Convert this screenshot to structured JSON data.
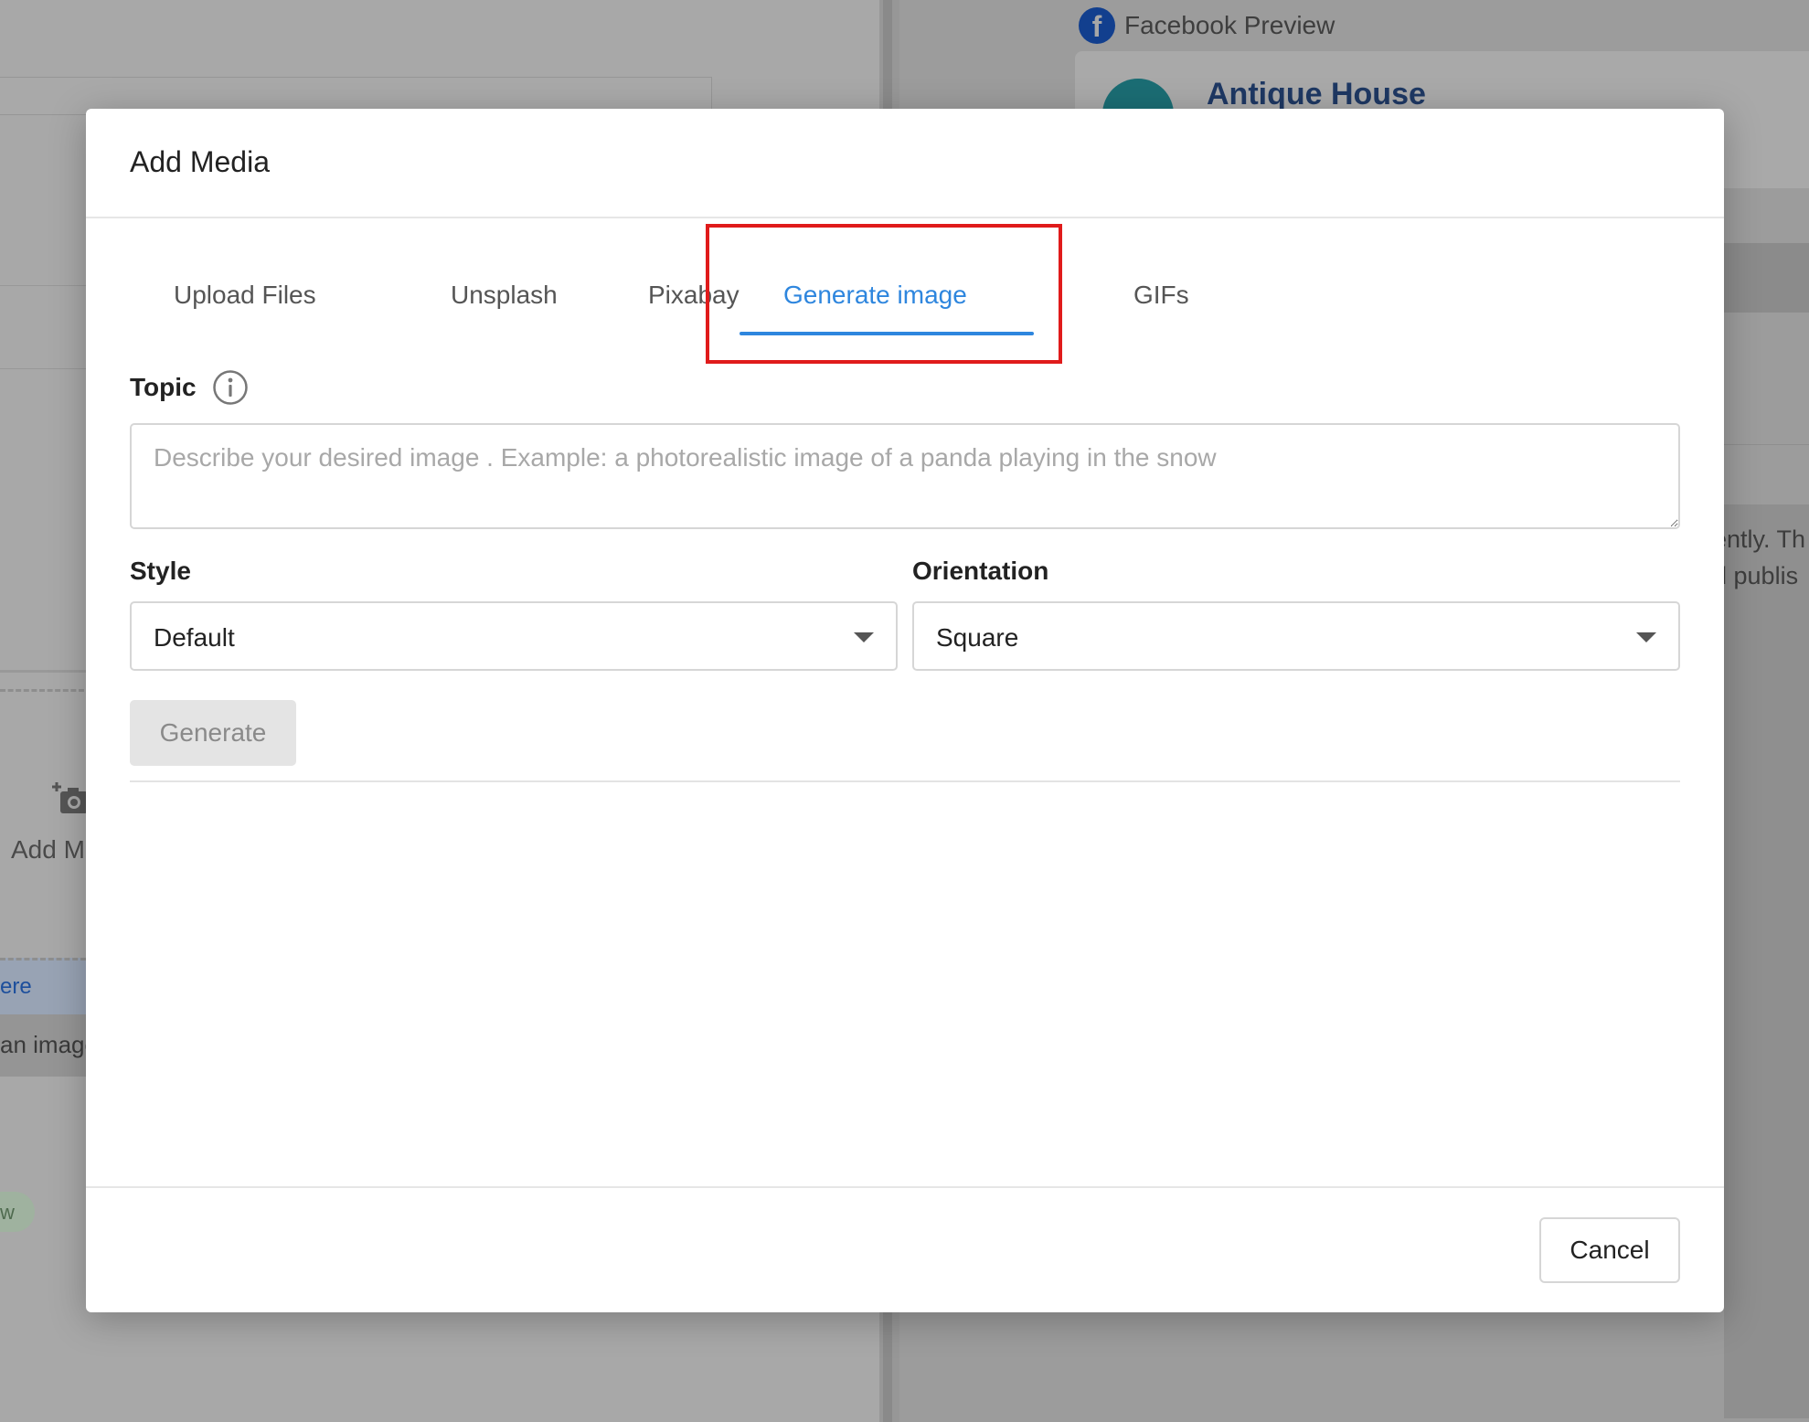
{
  "background": {
    "left": {
      "add_media_text": "Add M",
      "here_link": "ere",
      "image_text": "an image",
      "pill_text": "w"
    },
    "right": {
      "preview_title": "Facebook Preview",
      "page_name": "Antique House",
      "partial_line_1": "ently. Th",
      "partial_line_2": "d publis"
    }
  },
  "modal": {
    "title": "Add Media",
    "tabs": [
      {
        "label": "Upload Files",
        "active": false
      },
      {
        "label": "Unsplash",
        "active": false
      },
      {
        "label": "Pixabay",
        "active": false
      },
      {
        "label": "Generate image",
        "active": true
      },
      {
        "label": "GIFs",
        "active": false
      }
    ],
    "topic": {
      "label": "Topic",
      "placeholder": "Describe your desired image . Example: a photorealistic image of a panda playing in the snow",
      "value": ""
    },
    "style": {
      "label": "Style",
      "selected": "Default"
    },
    "orientation": {
      "label": "Orientation",
      "selected": "Square"
    },
    "generate_label": "Generate",
    "cancel_label": "Cancel"
  },
  "colors": {
    "accent": "#2e86de",
    "highlight": "#e01b1b",
    "disabled_bg": "#e4e4e4"
  }
}
